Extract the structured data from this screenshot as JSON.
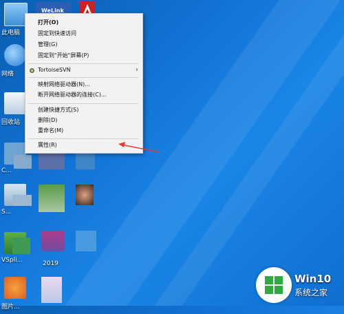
{
  "desktop": {
    "icons": [
      {
        "label": "此电脑"
      },
      {
        "label": "网络"
      },
      {
        "label": "回收站"
      },
      {
        "label": "C..."
      },
      {
        "label": "S..."
      },
      {
        "label": "VSpli..."
      },
      {
        "label": "2019"
      },
      {
        "label": "图片..."
      }
    ],
    "welink_label": "WeLink"
  },
  "context_menu": {
    "items": [
      {
        "label": "打开(O)"
      },
      {
        "label": "固定到快速访问"
      },
      {
        "label": "管理(G)"
      },
      {
        "label": "固定到\"开始\"屏幕(P)"
      },
      {
        "label": "TortoiseSVN"
      },
      {
        "label": "映射网络驱动器(N)..."
      },
      {
        "label": "断开网络驱动器的连接(C)..."
      },
      {
        "label": "创建快捷方式(S)"
      },
      {
        "label": "删除(D)"
      },
      {
        "label": "重命名(M)"
      },
      {
        "label": "属性(R)"
      }
    ],
    "submenu_arrow": "›"
  },
  "watermark": {
    "title": "Win10",
    "subtitle": "系统之家"
  },
  "colors": {
    "desktop": "#1273d6",
    "menu_bg": "#f2f2f2",
    "arrow": "#e53935"
  }
}
